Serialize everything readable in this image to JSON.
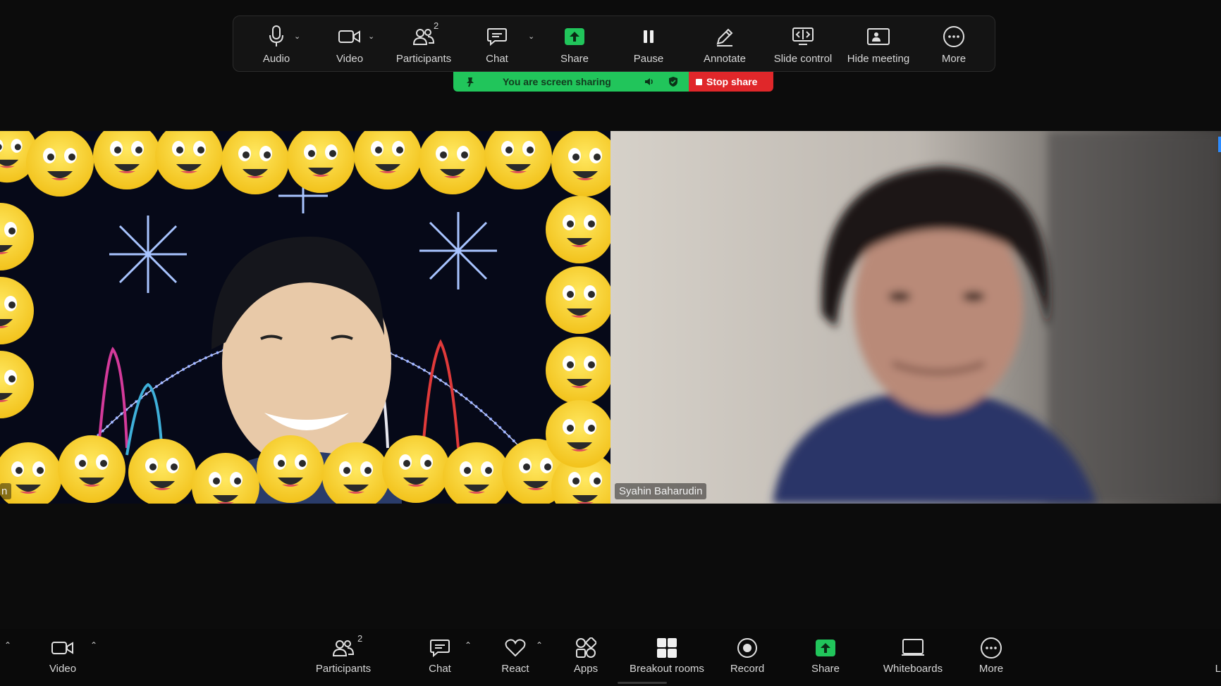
{
  "share_toolbar": {
    "audio": "Audio",
    "video": "Video",
    "participants": "Participants",
    "participants_count": "2",
    "chat": "Chat",
    "share": "Share",
    "pause": "Pause",
    "annotate": "Annotate",
    "slide_control": "Slide control",
    "hide_meeting": "Hide meeting",
    "more": "More"
  },
  "share_banner": {
    "status": "You are screen sharing",
    "stop": "Stop share"
  },
  "tiles": {
    "left_name": "n",
    "right_name": "Syahin Baharudin"
  },
  "bottom_bar": {
    "video": "Video",
    "participants": "Participants",
    "participants_count": "2",
    "chat": "Chat",
    "react": "React",
    "apps": "Apps",
    "breakout": "Breakout rooms",
    "record": "Record",
    "share": "Share",
    "whiteboards": "Whiteboards",
    "more": "More",
    "edge_label": "L"
  },
  "colors": {
    "share_green": "#21c55b",
    "stop_red": "#e0272a",
    "background": "#0c0c0c"
  }
}
